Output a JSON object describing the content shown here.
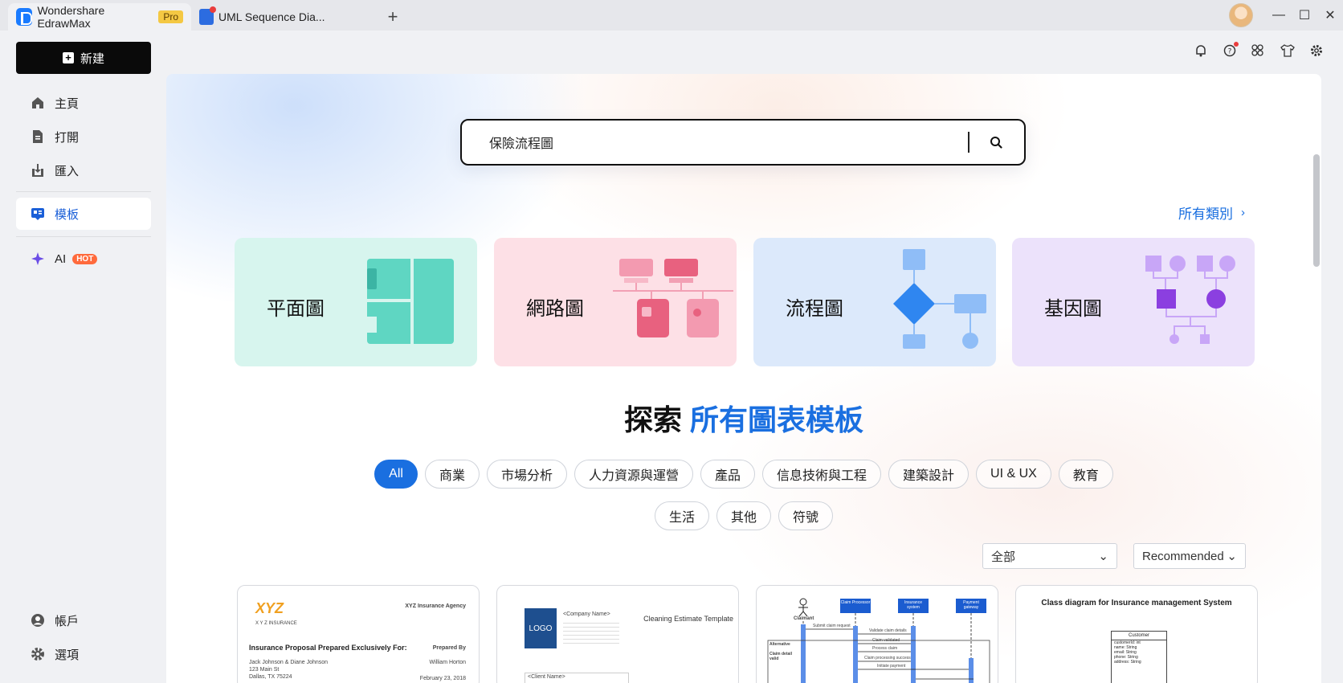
{
  "titlebar": {
    "app_tab_title": "Wondershare EdrawMax",
    "pro_badge": "Pro",
    "doc_tab_title": "UML Sequence Dia...",
    "new_tab": "+",
    "minimize": "—",
    "maximize": "☐",
    "close": "✕"
  },
  "sidebar": {
    "new_label": "新建",
    "items": [
      {
        "label": "主頁",
        "icon": "home-icon"
      },
      {
        "label": "打開",
        "icon": "document-icon"
      },
      {
        "label": "匯入",
        "icon": "import-icon"
      },
      {
        "label": "模板",
        "icon": "template-icon"
      },
      {
        "label": "AI",
        "icon": "sparkle-icon"
      }
    ],
    "hot_badge": "HOT",
    "account_label": "帳戶",
    "options_label": "選項"
  },
  "search": {
    "value": "保險流程圖"
  },
  "all_categories": "所有類別",
  "categories": [
    {
      "label": "平面圖",
      "color": "#d7f5ee"
    },
    {
      "label": "網路圖",
      "color": "#fde0e6"
    },
    {
      "label": "流程圖",
      "color": "#dce9fb"
    },
    {
      "label": "基因圖",
      "color": "#ece2fb"
    }
  ],
  "explore": {
    "prefix": "探索",
    "accent": "所有圖表模板"
  },
  "filters_row1": [
    "All",
    "商業",
    "市場分析",
    "人力資源與運營",
    "產品",
    "信息技術與工程",
    "建築設計",
    "UI & UX",
    "教育"
  ],
  "filters_row2": [
    "生活",
    "其他",
    "符號"
  ],
  "selects": {
    "scope": "全部",
    "sort": "Recommended"
  },
  "templates": {
    "t1": {
      "brand": "XYZ",
      "brand_sub": "X Y Z INSURANCE",
      "agency": "XYZ Insurance Agency",
      "title": "Insurance Proposal Prepared Exclusively For:",
      "prepared_by": "Prepared By",
      "client": "Jack Johnson & Diane Johnson",
      "address": "123 Main St",
      "city": "Dallas, TX 75224",
      "preparer": "William Horton",
      "date": "February 23, 2018"
    },
    "t2": {
      "logo": "LOGO",
      "company": "<Company Name>",
      "title": "Cleaning Estimate Template",
      "client_name": "<Client Name>"
    },
    "t3": {
      "claimant": "Claimant",
      "processor": "Claim Processor",
      "insurance": "Insurance system",
      "gateway": "Payment gateway",
      "msg1": "Submit claim request",
      "msg2": "Validate claim details",
      "msg3": "Claim validated",
      "msg4": "Process claim",
      "msg5": "Claim processing success",
      "msg6": "Initiate payment",
      "alt": "Alternative",
      "claim_valid": "Claim detail valid"
    },
    "t4": {
      "title": "Class diagram for Insurance management System",
      "class_name": "Customer",
      "attrs": [
        "customerId: int",
        "name: String",
        "email: String",
        "phone: String",
        "address: String"
      ]
    }
  }
}
